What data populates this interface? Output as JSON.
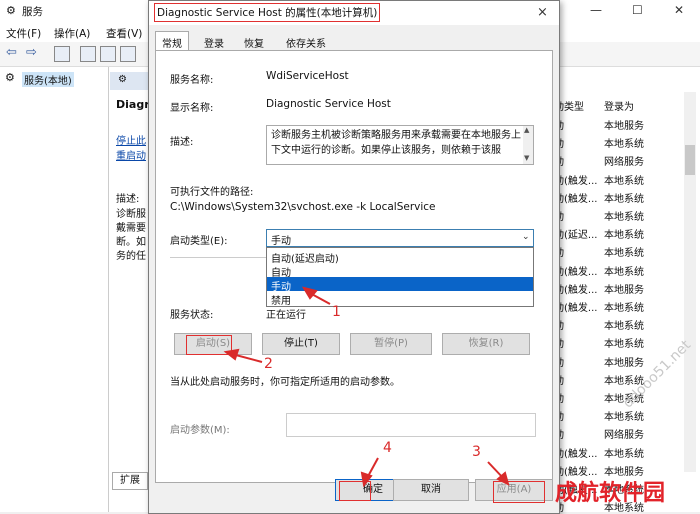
{
  "bg": {
    "title": "服务",
    "menu": [
      "文件(F)",
      "操作(A)",
      "查看(V)"
    ],
    "tree_item": "服务(本地)",
    "panel_header_title": "Diagr",
    "links": [
      "停止此",
      "重启动"
    ],
    "desc_label": "描述:",
    "desc_lines": [
      "诊断服",
      "戴需要",
      "断。如",
      "务的任"
    ],
    "bottom_tab": "扩展",
    "col_headers": [
      "动类型",
      "登录为"
    ],
    "rows": [
      [
        "动",
        "本地服务"
      ],
      [
        "动",
        "本地系统"
      ],
      [
        "动",
        "网络服务"
      ],
      [
        "动(触发...",
        "本地系统"
      ],
      [
        "动(触发...",
        "本地系统"
      ],
      [
        "动",
        "本地系统"
      ],
      [
        "动(延迟...",
        "本地系统"
      ],
      [
        "动",
        "本地系统"
      ],
      [
        "动(触发...",
        "本地系统"
      ],
      [
        "动(触发...",
        "本地服务"
      ],
      [
        "动(触发...",
        "本地系统"
      ],
      [
        "动",
        "本地系统"
      ],
      [
        "动",
        "本地系统"
      ],
      [
        "动",
        "本地服务"
      ],
      [
        "动",
        "本地系统"
      ],
      [
        "动",
        "本地系统"
      ],
      [
        "动",
        "本地系统"
      ],
      [
        "动",
        "网络服务"
      ],
      [
        "动(触发...",
        "本地系统"
      ],
      [
        "动(触发...",
        "本地服务"
      ],
      [
        "动(触发...",
        "本地系统"
      ],
      [
        "动",
        "本地系统"
      ]
    ]
  },
  "dialog": {
    "title": "Diagnostic Service Host 的属性(本地计算机)",
    "close_icon": "×",
    "tabs": [
      "常规",
      "登录",
      "恢复",
      "依存关系"
    ],
    "service_name_label": "服务名称:",
    "service_name": "WdiServiceHost",
    "display_name_label": "显示名称:",
    "display_name": "Diagnostic Service Host",
    "description_label": "描述:",
    "description": "诊断服务主机被诊断策略服务用来承载需要在本地服务上下文中运行的诊断。如果停止该服务，则依赖于该服",
    "exe_path_label": "可执行文件的路径:",
    "exe_path": "C:\\Windows\\System32\\svchost.exe -k LocalService",
    "startup_type_label": "启动类型(E):",
    "startup_type_value": "手动",
    "startup_options": [
      "自动(延迟启动)",
      "自动",
      "手动",
      "禁用"
    ],
    "startup_selected_index": 2,
    "status_label": "服务状态:",
    "status_value": "正在运行",
    "buttons": {
      "start": "启动(S)",
      "stop": "停止(T)",
      "pause": "暂停(P)",
      "resume": "恢复(R)"
    },
    "hint": "当从此处启动服务时，你可指定所适用的启动参数。",
    "param_label": "启动参数(M):",
    "param_value": "",
    "footer": {
      "ok": "确定",
      "cancel": "取消",
      "apply": "应用(A)"
    }
  },
  "annotations": [
    "1",
    "2",
    "3",
    "4"
  ],
  "watermark": {
    "text": "成航软件园",
    "url": "ddooo51.net"
  },
  "colors": {
    "annotation_red": "#d92a2a",
    "selection_blue": "#0a64c8",
    "link_blue": "#0a47a8"
  }
}
